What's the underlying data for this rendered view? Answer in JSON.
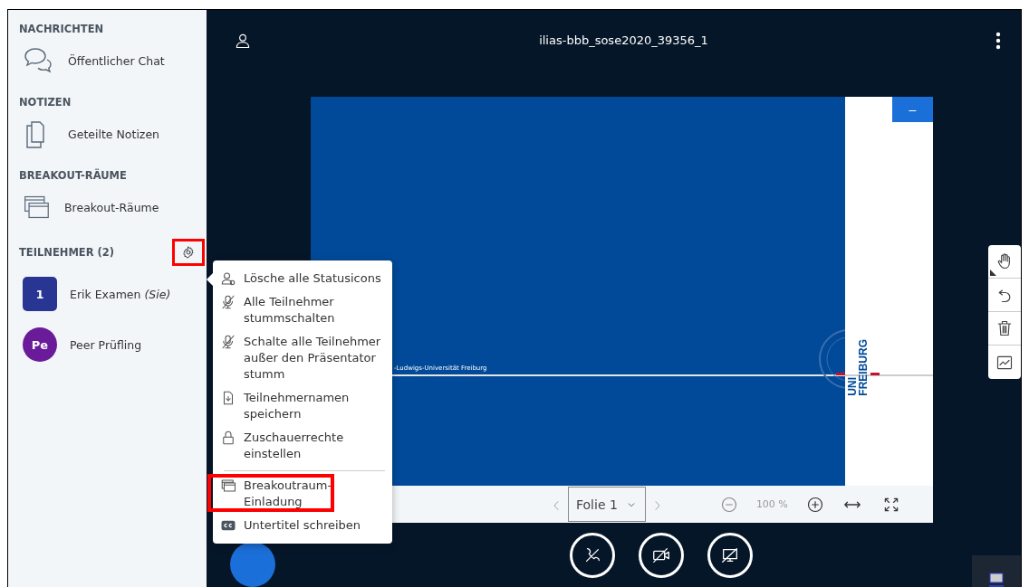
{
  "sidebar": {
    "sections": [
      {
        "title": "NACHRICHTEN",
        "items": [
          {
            "kind": "chat",
            "label": "Öffentlicher Chat"
          }
        ]
      },
      {
        "title": "NOTIZEN",
        "items": [
          {
            "kind": "notes",
            "label": "Geteilte Notizen"
          }
        ]
      },
      {
        "title": "BREAKOUT-RÄUME",
        "items": [
          {
            "kind": "rooms",
            "label": "Breakout-Räume"
          }
        ]
      }
    ],
    "participants": {
      "title": "TEILNEHMER (2)",
      "list": [
        {
          "avatar": "1",
          "name": "Erik Examen *(Sie)*",
          "color": "#283593",
          "kind": "moderator"
        },
        {
          "avatar": "Pe",
          "name": "Peer Prüfling",
          "color": "#6a1b9a",
          "kind": "viewer"
        }
      ]
    }
  },
  "header": {
    "title": "ilias-bbb_sose2020_39356_1"
  },
  "slide": {
    "footer_text": "-Ludwigs-Universität Freiburg",
    "logo_line_1": "UNI",
    "logo_line_2": "FREIBURG",
    "minimize_label": "–"
  },
  "slide_toolbar": {
    "slide_select": "Folie 1",
    "zoom": "100 %"
  },
  "settings_menu": {
    "items": [
      {
        "kind": "clear-status",
        "label": "Lösche alle Statusicons",
        "highlighted": false
      },
      {
        "kind": "mute",
        "label": "Alle Teilnehmer stummschalten",
        "highlighted": false
      },
      {
        "kind": "mute",
        "label": "Schalte alle Teilnehmer außer den Präsentator stumm",
        "highlighted": false
      },
      {
        "kind": "save",
        "label": "Teilnehmernamen speichern",
        "highlighted": false
      },
      {
        "kind": "lock",
        "label": "Zuschauerrechte einstellen",
        "highlighted": false
      },
      {
        "kind": "rooms",
        "label": "Breakoutraum-Einladung",
        "highlighted": true,
        "divider_before": true
      },
      {
        "kind": "captions",
        "label": "Untertitel schreiben",
        "highlighted": false
      }
    ]
  },
  "settings_button": {
    "highlighted": true
  }
}
